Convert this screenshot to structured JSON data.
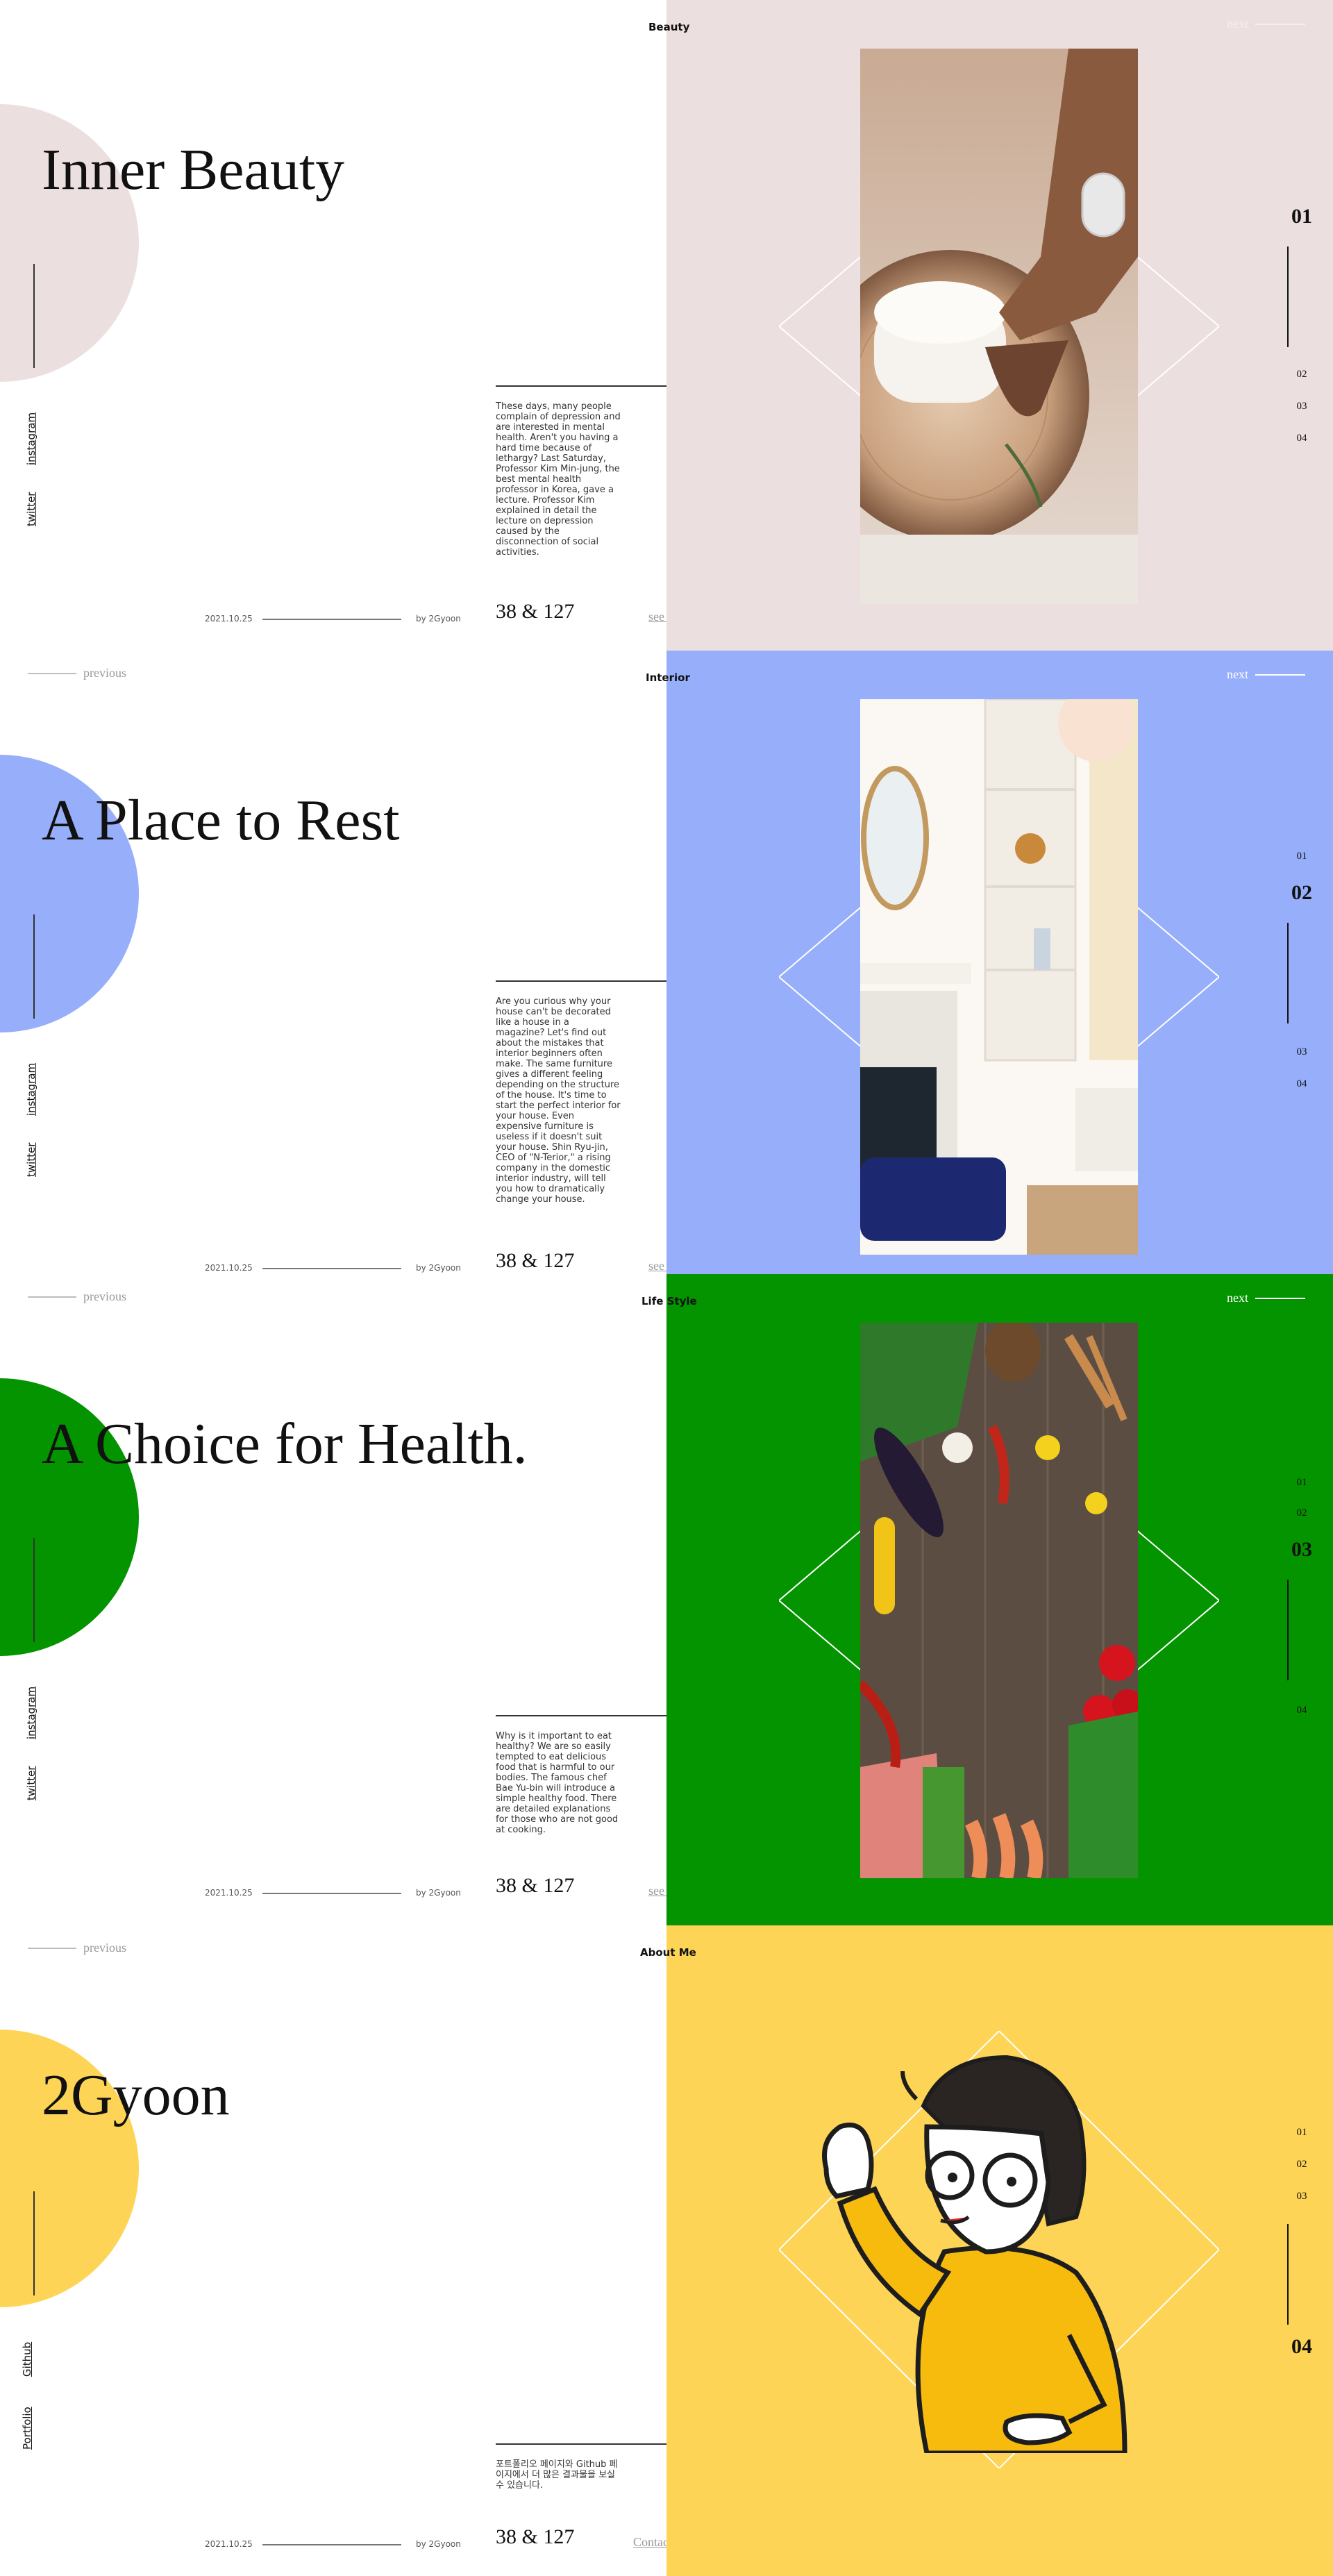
{
  "colors": {
    "beauty": "#ecdfdf",
    "interior": "#97aefb",
    "lifestyle": "#039400",
    "about": "#fdd455"
  },
  "sections": [
    {
      "category": "Beauty",
      "title": "Inner Beauty",
      "social": [
        "instagram",
        "twitter"
      ],
      "description": "These days, many people complain of depression and are interested in mental health. Aren't you having a hard time because of lethargy? Last Saturday, Professor Kim Min-jung, the best mental health professor in Korea, gave a lecture. Professor Kim explained in detail the lecture on depression caused by the disconnection of social activities.",
      "counts": "38 & 127",
      "link": "see all",
      "date": "2021.10.25",
      "author": "by 2Gyoon",
      "next": "next",
      "previous": "",
      "pages": [
        "01",
        "02",
        "03",
        "04"
      ],
      "active_page": "01",
      "image": "hand-with-candle-photo"
    },
    {
      "category": "Interior",
      "title": "A Place to Rest",
      "social": [
        "instagram",
        "twitter"
      ],
      "description": "Are you curious why your house can't be decorated like a house in a magazine? Let's find out about the mistakes that interior beginners often make. The same furniture gives a different feeling depending on the structure of the house. It's time to start the perfect interior for your house. Even expensive furniture is useless if it doesn't suit your house. Shin Ryu-jin, CEO of \"N-Terior,\" a rising company in the domestic interior industry, will tell you how to dramatically change your house.",
      "counts": "38 & 127",
      "link": "see all",
      "date": "2021.10.25",
      "author": "by 2Gyoon",
      "next": "next",
      "previous": "previous",
      "pages": [
        "01",
        "02",
        "03",
        "04"
      ],
      "active_page": "02",
      "image": "living-room-photo"
    },
    {
      "category": "Life Style",
      "title": "A Choice for Health.",
      "social": [
        "instagram",
        "twitter"
      ],
      "description": "Why is it important to eat healthy? We are so easily tempted to eat delicious food that is harmful to our bodies. The famous chef Bae Yu-bin will introduce a simple healthy food. There are detailed explanations for those who are not good at cooking.",
      "counts": "38 & 127",
      "link": "see all",
      "date": "2021.10.25",
      "author": "by 2Gyoon",
      "next": "next",
      "previous": "previous",
      "pages": [
        "01",
        "02",
        "03",
        "04"
      ],
      "active_page": "03",
      "image": "vegetables-on-wood-photo"
    },
    {
      "category": "About Me",
      "title": "2Gyoon",
      "social": [
        "Github",
        "Portfolio"
      ],
      "description": "포트폴리오 페이지와 Github 페이지에서 더 많은 결과물을 보실 수 있습니다.",
      "counts": "38 & 127",
      "link": "Contact Me",
      "date": "2021.10.25",
      "author": "by 2Gyoon",
      "next": "",
      "previous": "previous",
      "pages": [
        "01",
        "02",
        "03",
        "04"
      ],
      "active_page": "04",
      "image": "cartoon-avatar-illustration"
    }
  ]
}
